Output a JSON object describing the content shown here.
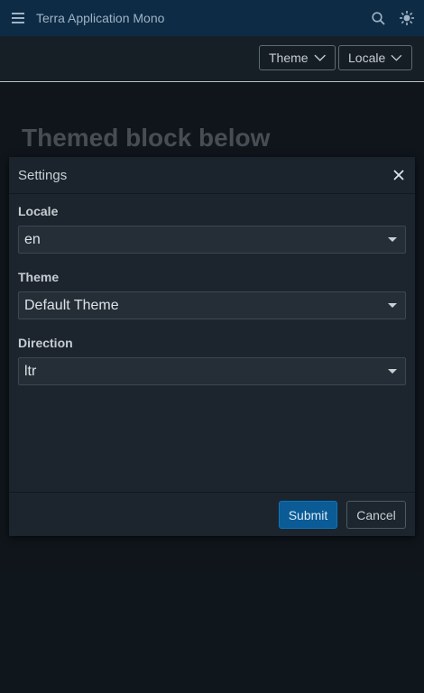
{
  "app": {
    "title": "Terra Application Mono"
  },
  "toolbar": {
    "theme_label": "Theme",
    "locale_label": "Locale"
  },
  "page": {
    "heading": "Themed block below"
  },
  "modal": {
    "title": "Settings",
    "fields": [
      {
        "label": "Locale",
        "value": "en"
      },
      {
        "label": "Theme",
        "value": "Default Theme"
      },
      {
        "label": "Direction",
        "value": "ltr"
      }
    ],
    "submit_label": "Submit",
    "cancel_label": "Cancel"
  },
  "colors": {
    "header_bg": "#0d2b45",
    "page_bg": "#141c23",
    "primary": "#0a5b96"
  },
  "icons": [
    "hamburger-icon",
    "search-icon",
    "sun-icon",
    "chevron-down-icon",
    "close-icon",
    "caret-down-icon"
  ]
}
